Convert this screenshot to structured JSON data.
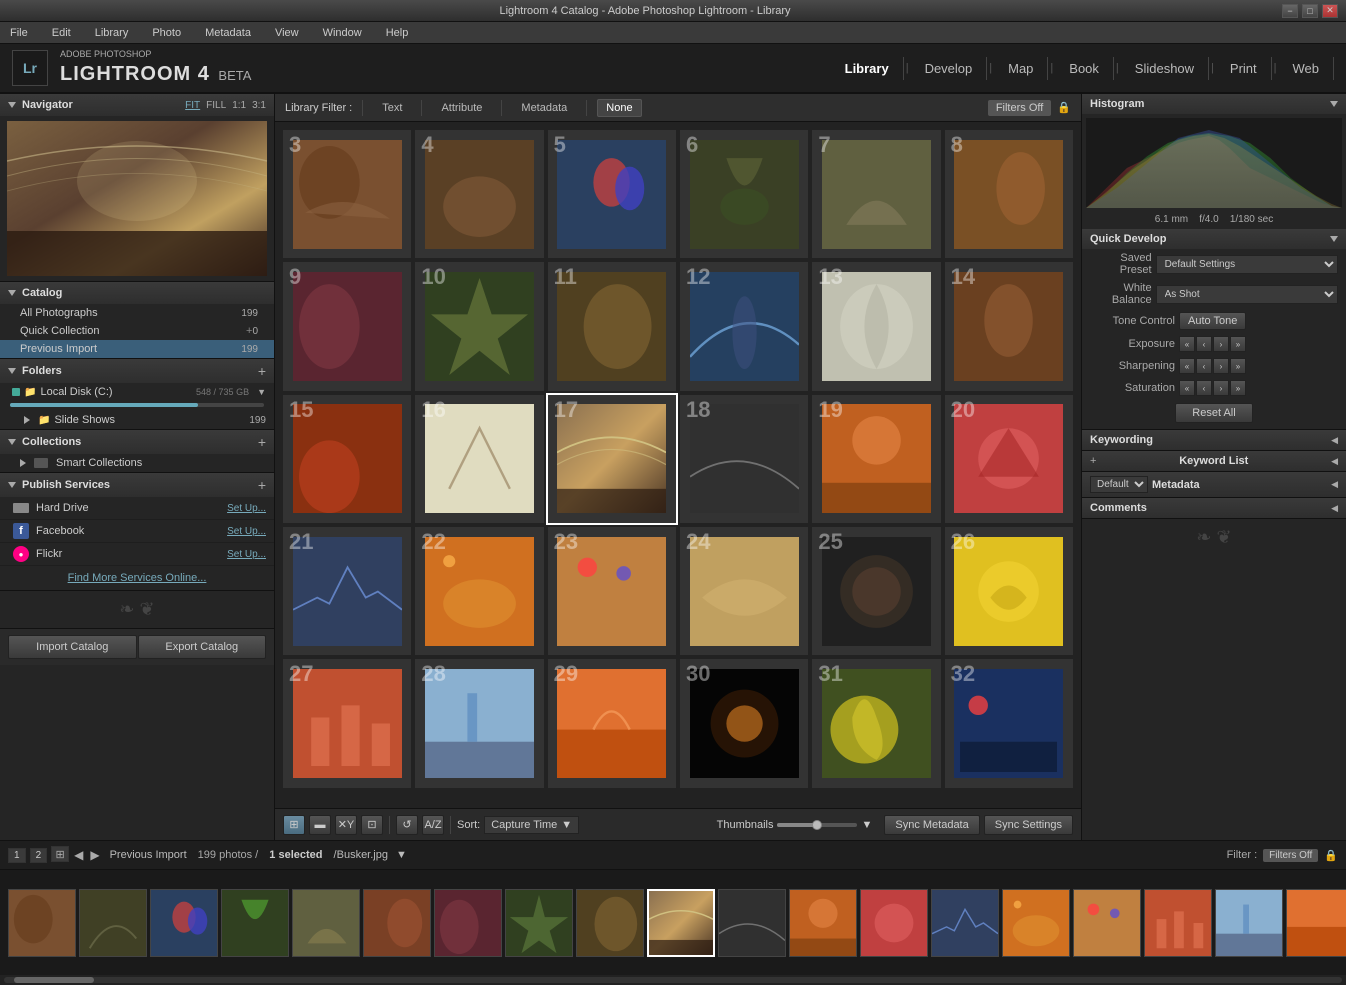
{
  "titlebar": {
    "title": "Lightroom 4 Catalog - Adobe Photoshop Lightroom - Library",
    "min": "−",
    "max": "□",
    "close": "✕"
  },
  "menubar": {
    "items": [
      "File",
      "Edit",
      "Library",
      "Photo",
      "Metadata",
      "View",
      "Window",
      "Help"
    ]
  },
  "header": {
    "lr_text": "Lr",
    "adobe": "ADOBE PHOTOSHOP",
    "name": "LIGHTROOM 4",
    "beta": "BETA",
    "nav_tabs": [
      {
        "label": "Library",
        "active": true
      },
      {
        "label": "Develop",
        "active": false
      },
      {
        "label": "Map",
        "active": false
      },
      {
        "label": "Book",
        "active": false
      },
      {
        "label": "Slideshow",
        "active": false
      },
      {
        "label": "Print",
        "active": false
      },
      {
        "label": "Web",
        "active": false
      }
    ]
  },
  "navigator": {
    "label": "Navigator",
    "zoom_levels": [
      "FIT",
      "FILL",
      "1:1",
      "3:1"
    ]
  },
  "catalog": {
    "label": "Catalog",
    "items": [
      {
        "name": "All Photographs",
        "count": "199"
      },
      {
        "name": "Quick Collection",
        "count": "0",
        "plus": "+"
      },
      {
        "name": "Previous Import",
        "count": "199"
      }
    ]
  },
  "folders": {
    "label": "Folders",
    "add": "+",
    "disk": {
      "name": "Local Disk (C:)",
      "space": "548 / 735 GB",
      "fill_pct": 74
    },
    "items": [
      {
        "name": "Slide Shows",
        "count": "199"
      }
    ]
  },
  "collections": {
    "label": "Collections",
    "add": "+",
    "items": [
      {
        "name": "Smart Collections"
      }
    ]
  },
  "publish_services": {
    "label": "Publish Services",
    "add": "+",
    "services": [
      {
        "name": "Hard Drive",
        "setup": "Set Up..."
      },
      {
        "name": "Facebook",
        "setup": "Set Up..."
      },
      {
        "name": "Flickr",
        "setup": "Set Up..."
      }
    ],
    "find_more": "Find More Services Online..."
  },
  "bottom_left": {
    "import": "Import Catalog",
    "export": "Export Catalog"
  },
  "filter_bar": {
    "label": "Library Filter :",
    "tabs": [
      "Text",
      "Attribute",
      "Metadata",
      "None"
    ],
    "active": "None",
    "filters_off": "Filters Off",
    "lock_icon": "🔒"
  },
  "photos": {
    "count": 24,
    "selected_index": 14,
    "colors": [
      "photo-1",
      "photo-2",
      "photo-3",
      "photo-4",
      "photo-5",
      "photo-6",
      "photo-7",
      "photo-8",
      "photo-9",
      "photo-10",
      "photo-11",
      "photo-12",
      "photo-13",
      "photo-14",
      "photo-15",
      "photo-16",
      "photo-17",
      "photo-18",
      "photo-19",
      "photo-20",
      "photo-21",
      "photo-22",
      "photo-23",
      "photo-24",
      "photo-25",
      "photo-26",
      "photo-27",
      "photo-28",
      "photo-29",
      "photo-1"
    ],
    "numbers": [
      3,
      4,
      5,
      6,
      7,
      8,
      9,
      10,
      11,
      12,
      13,
      14,
      15,
      16,
      17,
      18,
      19,
      20,
      21,
      22,
      23,
      24,
      25,
      26,
      27,
      28,
      29,
      30
    ]
  },
  "toolbar": {
    "view_btns": [
      "⊞",
      "▬",
      "✕Y",
      "⊡"
    ],
    "sort_label": "Sort:",
    "sort_value": "Capture Time",
    "thumbnails_label": "Thumbnails",
    "sync_metadata": "Sync Metadata",
    "sync_settings": "Sync Settings"
  },
  "histogram": {
    "label": "Histogram",
    "focal": "6.1 mm",
    "aperture": "f/4.0",
    "shutter": "1/180 sec"
  },
  "quick_develop": {
    "label": "Quick Develop",
    "saved_preset_label": "Saved Preset",
    "saved_preset_value": "Default Settings",
    "white_balance_label": "White Balance",
    "white_balance_value": "As Shot",
    "tone_control_label": "Tone Control",
    "auto_tone": "Auto Tone",
    "exposure_label": "Exposure",
    "sharpening_label": "Sharpening",
    "saturation_label": "Saturation",
    "reset_all": "Reset All"
  },
  "keywording": {
    "label": "Keywording"
  },
  "keyword_list": {
    "label": "Keyword List",
    "add": "+"
  },
  "metadata": {
    "label": "Metadata",
    "default": "Default"
  },
  "comments": {
    "label": "Comments"
  },
  "filmstrip": {
    "page_left": "1",
    "page_right": "2",
    "prev_icon": "◀",
    "next_icon": "▶",
    "collection": "Previous Import",
    "photo_count": "199 photos /",
    "selected": "1 selected",
    "filename": "/Busker.jpg",
    "filter_label": "Filter :",
    "filters_off": "Filters Off"
  },
  "filmstrip_colors": [
    "photo-1",
    "photo-2",
    "photo-3",
    "photo-4",
    "photo-5",
    "photo-6",
    "photo-7",
    "photo-8",
    "photo-9",
    "photo-10",
    "photo-11",
    "photo-12",
    "photo-13",
    "photo-14",
    "photo-15",
    "photo-16",
    "photo-17",
    "photo-18",
    "photo-19",
    "photo-20"
  ]
}
